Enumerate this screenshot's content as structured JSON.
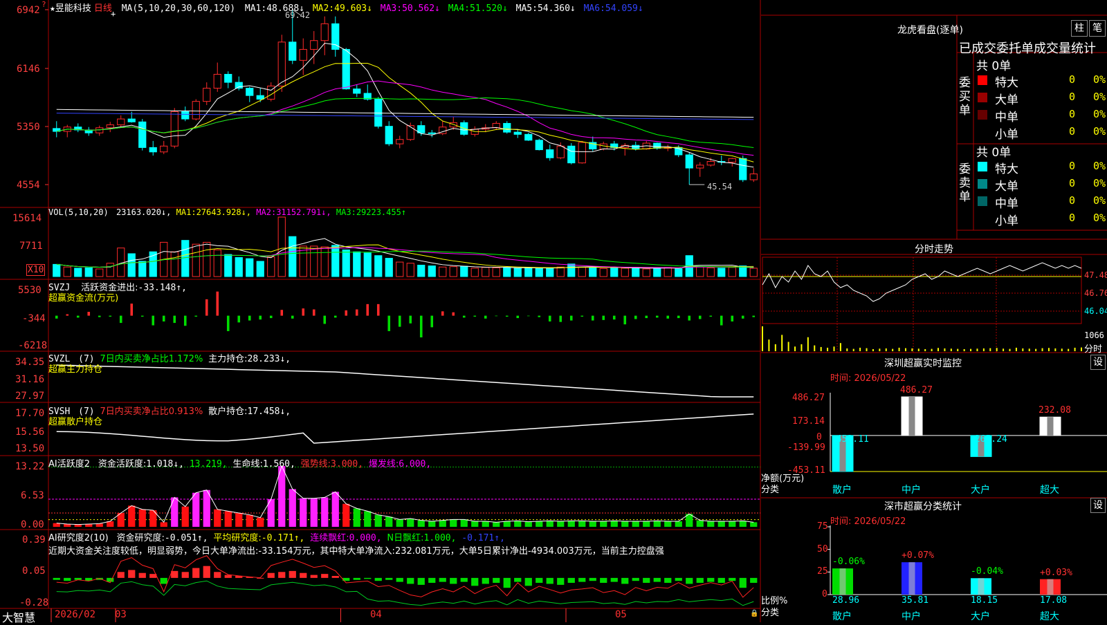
{
  "app": {
    "brand": "大智慧",
    "lock_icon": "lock-icon"
  },
  "colors": {
    "up": "#ff2a2a",
    "down": "#00ffff",
    "green": "#00cc22",
    "ma1": "#ffffff",
    "ma2": "#ffff00",
    "ma3": "#ff00ff",
    "ma4": "#00ff00",
    "ma5": "#ffffff",
    "ma6": "#3344ff",
    "grid": "#aa0000",
    "axis": "#ff3030"
  },
  "kline": {
    "star": "★",
    "stock_name": "昱能科技",
    "period": "日线",
    "ma_params": "MA(5,10,20,30,60,120)",
    "ma_values": [
      {
        "label": "MA1:",
        "value": "48.688↓"
      },
      {
        "label": "MA2:",
        "value": "49.603↓"
      },
      {
        "label": "MA3:",
        "value": "50.562↓"
      },
      {
        "label": "MA4:",
        "value": "51.520↓"
      },
      {
        "label": "MA5:",
        "value": "54.360↓"
      },
      {
        "label": "MA6:",
        "value": "54.059↓"
      }
    ],
    "high_label": "69.42",
    "low_label": "45.54",
    "y_labels": [
      "6942",
      "6146",
      "5350",
      "4554"
    ],
    "ymax": 69.42,
    "ymin": 45.54,
    "candles": [
      [
        53.2,
        54.2,
        52.0,
        52.8
      ],
      [
        52.8,
        53.7,
        52.0,
        53.4
      ],
      [
        53.4,
        53.9,
        52.7,
        53.0
      ],
      [
        53.0,
        53.4,
        52.2,
        52.6
      ],
      [
        52.6,
        53.6,
        52.2,
        53.3
      ],
      [
        53.3,
        54.1,
        52.7,
        53.7
      ],
      [
        53.7,
        55.0,
        53.3,
        54.5
      ],
      [
        54.5,
        55.5,
        54.0,
        54.1
      ],
      [
        54.1,
        54.5,
        50.2,
        50.6
      ],
      [
        50.6,
        51.5,
        49.5,
        50.0
      ],
      [
        50.0,
        51.5,
        49.7,
        50.8
      ],
      [
        50.8,
        56.0,
        50.5,
        55.5
      ],
      [
        55.5,
        56.2,
        54.2,
        54.5
      ],
      [
        54.5,
        57.2,
        54.3,
        56.9
      ],
      [
        56.9,
        59.5,
        56.4,
        58.7
      ],
      [
        58.7,
        62.2,
        58.2,
        60.6
      ],
      [
        60.6,
        61.0,
        58.7,
        59.5
      ],
      [
        59.5,
        60.3,
        58.4,
        58.7
      ],
      [
        58.7,
        58.9,
        56.8,
        57.7
      ],
      [
        57.7,
        58.7,
        56.8,
        57.2
      ],
      [
        57.2,
        59.5,
        56.9,
        59.0
      ],
      [
        59.0,
        66.0,
        58.2,
        65.0
      ],
      [
        65.0,
        69.42,
        62.0,
        62.5
      ],
      [
        62.5,
        65.5,
        60.5,
        64.0
      ],
      [
        64.0,
        66.5,
        62.0,
        65.2
      ],
      [
        65.2,
        68.5,
        63.2,
        67.5
      ],
      [
        67.5,
        68.5,
        63.0,
        64.0
      ],
      [
        64.0,
        64.2,
        58.5,
        58.6
      ],
      [
        58.6,
        59.2,
        57.5,
        58.0
      ],
      [
        58.0,
        59.2,
        57.0,
        57.2
      ],
      [
        57.2,
        57.5,
        53.2,
        53.5
      ],
      [
        53.5,
        54.2,
        50.8,
        51.1
      ],
      [
        51.1,
        52.2,
        50.5,
        51.7
      ],
      [
        51.7,
        54.0,
        51.5,
        53.6
      ],
      [
        53.6,
        54.2,
        52.2,
        52.6
      ],
      [
        52.6,
        53.0,
        52.0,
        52.5
      ],
      [
        52.5,
        54.2,
        52.3,
        53.4
      ],
      [
        53.4,
        54.8,
        53.0,
        54.0
      ],
      [
        54.0,
        54.3,
        52.2,
        52.4
      ],
      [
        52.4,
        53.5,
        52.1,
        53.1
      ],
      [
        53.1,
        53.8,
        52.7,
        53.3
      ],
      [
        53.3,
        54.2,
        53.0,
        53.9
      ],
      [
        53.9,
        54.2,
        52.5,
        52.7
      ],
      [
        52.7,
        53.0,
        51.9,
        52.4
      ],
      [
        52.4,
        52.6,
        51.5,
        51.6
      ],
      [
        51.6,
        51.8,
        50.2,
        50.3
      ],
      [
        50.3,
        51.0,
        48.8,
        49.2
      ],
      [
        49.2,
        51.3,
        49.0,
        50.8
      ],
      [
        50.8,
        51.2,
        48.3,
        48.5
      ],
      [
        48.5,
        51.5,
        48.4,
        51.3
      ],
      [
        51.3,
        52.1,
        50.1,
        50.4
      ],
      [
        50.4,
        51.4,
        50.2,
        51.1
      ],
      [
        51.1,
        51.5,
        50.2,
        50.6
      ],
      [
        50.6,
        51.2,
        49.5,
        50.9
      ],
      [
        50.9,
        51.4,
        50.2,
        50.4
      ],
      [
        50.4,
        51.5,
        50.3,
        51.2
      ],
      [
        51.2,
        51.3,
        50.3,
        50.5
      ],
      [
        50.5,
        51.0,
        50.1,
        50.6
      ],
      [
        50.6,
        50.9,
        49.3,
        49.6
      ],
      [
        49.6,
        49.9,
        45.54,
        47.8
      ],
      [
        47.8,
        48.6,
        46.6,
        48.2
      ],
      [
        48.2,
        49.2,
        48.0,
        48.7
      ],
      [
        48.7,
        49.5,
        48.2,
        48.6
      ],
      [
        48.6,
        49.2,
        48.0,
        49.1
      ],
      [
        49.1,
        49.5,
        45.9,
        46.2
      ],
      [
        46.2,
        47.8,
        45.9,
        47.0
      ]
    ]
  },
  "vol": {
    "params": "VOL(5,10,20)",
    "value": "23163.020↓,",
    "ma": [
      {
        "label": "MA1:",
        "value": "27643.928↓,"
      },
      {
        "label": "MA2:",
        "value": "31152.791↓,"
      },
      {
        "label": "MA3:",
        "value": "29223.455↑"
      }
    ],
    "y_labels": [
      "15614",
      "7711"
    ],
    "unit": "X10",
    "ymax": 15614,
    "values": [
      3200,
      2500,
      2200,
      2300,
      2000,
      3500,
      7500,
      6000,
      4000,
      6500,
      9000,
      6500,
      9500,
      8500,
      9000,
      7000,
      5800,
      5000,
      4700,
      4000,
      5200,
      15614,
      10500,
      8000,
      8000,
      7800,
      8200,
      7000,
      6500,
      6200,
      5500,
      4800,
      3800,
      3500,
      3000,
      2800,
      2500,
      2600,
      2700,
      2200,
      2400,
      2300,
      2400,
      2200,
      2300,
      2100,
      2200,
      2500,
      3300,
      2500,
      2400,
      2100,
      2300,
      2200,
      2400,
      2000,
      2100,
      2400,
      2100,
      5500,
      2600,
      2300,
      2200,
      2400,
      2800,
      2200
    ]
  },
  "svzj": {
    "title": "SVZJ",
    "line1_label": "活跃资金进出:",
    "line1_value": "-33.148↑,",
    "line2": "超赢资金流(万元)",
    "y_labels": [
      "5530",
      "-344",
      "-6218"
    ],
    "ymax": 5530,
    "ymin": -6218,
    "values": [
      -600,
      300,
      -400,
      800,
      -300,
      -200,
      -1500,
      2500,
      -200,
      -2000,
      -1200,
      -1500,
      -2100,
      -200,
      3400,
      5000,
      -3200,
      -1400,
      -1000,
      -800,
      -500,
      1200,
      -600,
      1500,
      1300,
      -1700,
      -400,
      1100,
      1300,
      2400,
      2400,
      -3200,
      -2300,
      -1600,
      -4500,
      -2400,
      900,
      700,
      -400,
      -200,
      -600,
      -100,
      -200,
      -500,
      -100,
      -300,
      -1200,
      -1300,
      -1000,
      -200,
      -1000,
      -900,
      -800,
      -1800,
      -700,
      -500,
      -400,
      -600,
      -500,
      -1000,
      -700,
      -200,
      -2000,
      -1200,
      -600,
      -300
    ]
  },
  "svzl": {
    "title": "SVZL",
    "params": "(7)",
    "ratio_text": "7日内买卖净占比1.172%",
    "holding_label": "主力持仓:",
    "holding_value": "28.233↓,",
    "line2": "超赢主力持仓",
    "y_labels": [
      "34.35",
      "31.16",
      "27.97"
    ],
    "ymax": 34.35,
    "ymin": 27.97
  },
  "svsh": {
    "title": "SVSH",
    "params": "(7)",
    "ratio_text": "7日内买卖净占比0.913%",
    "holding_label": "散户持仓:",
    "holding_value": "17.458↓,",
    "line2": "超赢散户持仓",
    "y_labels": [
      "17.70",
      "15.56",
      "13.50"
    ],
    "ymax": 17.7,
    "ymin": 13.5
  },
  "ai_active": {
    "title": "AI活跃度2",
    "label": "资金活跃度:",
    "value": "1.018↓,",
    "value2": "13.219,",
    "life_label": "生命线:",
    "life_value": "1.560,",
    "strong_label": "强势线:",
    "strong_value": "3.000,",
    "burst_label": "爆发线:",
    "burst_value": "6.000,",
    "y_labels": [
      "13.22",
      "6.53",
      "0.00"
    ],
    "ymax": 13.22,
    "values": [
      0.8,
      0.6,
      0.5,
      0.6,
      0.7,
      1.2,
      3.0,
      4.6,
      3.8,
      3.6,
      1.0,
      6.4,
      4.4,
      7.4,
      8.0,
      3.8,
      3.4,
      3.0,
      2.6,
      2.0,
      6.0,
      13.2,
      8.2,
      6.2,
      6.2,
      6.4,
      7.6,
      5.0,
      4.0,
      3.4,
      2.6,
      2.2,
      1.6,
      1.8,
      1.4,
      1.2,
      1.4,
      1.6,
      1.6,
      1.2,
      1.2,
      1.0,
      1.2,
      1.3,
      1.1,
      1.2,
      1.3,
      1.2,
      1.3,
      1.3,
      1.2,
      1.2,
      1.3,
      1.2,
      1.2,
      1.2,
      1.3,
      1.2,
      1.2,
      2.8,
      1.4,
      1.2,
      1.2,
      1.2,
      1.3,
      1.0
    ]
  },
  "ai_research": {
    "title": "AI研究度2(10)",
    "label": "资金研究度:",
    "value": "-0.051↑,",
    "avg_label": "平均研究度:",
    "avg_value": "-0.171↑,",
    "red_label": "连续飘红:",
    "red_value": "0.000,",
    "nred_label": "N日飘红:",
    "nred_value": "1.000,",
    "last_value": "-0.171↑,",
    "comment": "近期大资金关注度较低，明显弱势，今日大单净流出:-33.154万元，其中特大单净流入:232.081万元，大单5日累计净出-4934.003万元，当前主力控盘强",
    "y_labels": [
      "0.39",
      "0.05",
      "-0.28"
    ],
    "ymax": 0.39,
    "ymin": -0.28,
    "values": [
      -0.02,
      -0.03,
      -0.02,
      -0.03,
      -0.02,
      -0.04,
      0.06,
      0.08,
      0.05,
      0.04,
      -0.06,
      0.07,
      0.06,
      0.1,
      0.12,
      0.06,
      0.03,
      0.02,
      0.01,
      0.0,
      0.05,
      0.06,
      0.07,
      0.05,
      0.03,
      0.04,
      0.02,
      -0.03,
      -0.02,
      -0.01,
      -0.03,
      -0.02,
      -0.04,
      -0.06,
      -0.07,
      -0.05,
      -0.04,
      -0.06,
      -0.04,
      -0.08,
      -0.06,
      -0.05,
      -0.1,
      -0.04,
      -0.08,
      -0.05,
      -0.06,
      -0.07,
      -0.05,
      -0.04,
      -0.03,
      -0.05,
      -0.04,
      -0.06,
      -0.03,
      -0.05,
      -0.04,
      -0.05,
      -0.03,
      -0.06,
      -0.05,
      -0.04,
      -0.05,
      -0.03,
      -0.1,
      -0.05
    ]
  },
  "xaxis": {
    "labels": [
      {
        "text": "2026/02",
        "bar": 0
      },
      {
        "text": "03",
        "bar": 6
      },
      {
        "text": "04",
        "bar": 27
      },
      {
        "text": "05",
        "bar": 48
      }
    ]
  },
  "dragon": {
    "title": "龙虎看盘(逐单)",
    "btn1": "柱",
    "btn2": "笔",
    "subtitle": "已成交委托单成交量统计",
    "buy_vlabel": "委买单",
    "sell_vlabel": "委卖单",
    "buy_total": "共 0单",
    "sell_total": "共 0单",
    "buy_rows": [
      {
        "name": "特大",
        "v": "0",
        "p": "0%",
        "c": "#ff0000"
      },
      {
        "name": "大单",
        "v": "0",
        "p": "0%",
        "c": "#990000"
      },
      {
        "name": "中单",
        "v": "0",
        "p": "0%",
        "c": "#660000"
      },
      {
        "name": "小单",
        "v": "0",
        "p": "0%",
        "c": ""
      }
    ],
    "sell_rows": [
      {
        "name": "特大",
        "v": "0",
        "p": "0%",
        "c": "#00ffff"
      },
      {
        "name": "大单",
        "v": "0",
        "p": "0%",
        "c": "#008888"
      },
      {
        "name": "中单",
        "v": "0",
        "p": "0%",
        "c": "#006666"
      },
      {
        "name": "小单",
        "v": "0",
        "p": "0%",
        "c": ""
      }
    ]
  },
  "minute": {
    "title": "分时走势",
    "y_labels": [
      "47.48",
      "46.76",
      "46.04"
    ],
    "vol_label": "1066",
    "vol_unit": "分时",
    "price_max": 48.2,
    "price_min": 45.8,
    "prices": [
      47.2,
      47.6,
      47.1,
      47.5,
      47.3,
      47.7,
      47.4,
      47.9,
      47.6,
      47.5,
      47.7,
      47.3,
      47.1,
      47.2,
      47.0,
      46.9,
      46.8,
      46.6,
      46.7,
      46.9,
      47.0,
      47.1,
      47.2,
      47.4,
      47.5,
      47.6,
      47.4,
      47.5,
      47.7,
      47.6,
      47.5,
      47.6,
      47.7,
      47.8,
      47.7,
      47.6,
      47.7,
      47.8,
      47.9,
      47.8,
      47.7,
      47.8,
      47.9,
      48.0,
      47.9,
      47.8,
      47.9,
      47.8,
      47.9,
      47.8
    ],
    "avg": [
      47.5,
      47.5,
      47.5,
      47.5,
      47.5,
      47.5,
      47.5,
      47.5,
      47.5,
      47.5,
      47.5,
      47.5,
      47.5,
      47.5,
      47.5,
      47.5,
      47.5,
      47.5,
      47.5,
      47.5,
      47.5,
      47.5,
      47.5,
      47.5,
      47.5,
      47.5,
      47.5,
      47.5,
      47.5,
      47.5,
      47.5,
      47.5,
      47.5,
      47.5,
      47.5,
      47.5,
      47.5,
      47.5,
      47.5,
      47.5,
      47.5,
      47.5,
      47.5,
      47.5,
      47.5,
      47.5,
      47.5,
      47.5,
      47.5,
      47.5
    ],
    "vols": [
      1066,
      500,
      300,
      700,
      400,
      200,
      300,
      600,
      250,
      180,
      150,
      200,
      350,
      120,
      100,
      150,
      130,
      90,
      110,
      120,
      100,
      150,
      130,
      120,
      110,
      90,
      100,
      140,
      120,
      110,
      100,
      90,
      100,
      110,
      120,
      130,
      140,
      110,
      100,
      150,
      120,
      110,
      100,
      130,
      140,
      120,
      110,
      100,
      150,
      160
    ]
  },
  "sz_monitor": {
    "title": "深圳超赢实时监控",
    "btn": "设",
    "time": "时间: 2026/05/22",
    "y_labels": [
      "486.27",
      "173.14",
      "0",
      "-139.99",
      "-453.11"
    ],
    "ymax": 486.27,
    "ymin": -453.11,
    "ylabel1": "净额(万元)",
    "ylabel2": "分类",
    "bars": [
      {
        "cat": "散户",
        "value": -453.11,
        "label": "-453.11",
        "color": "#00ffff"
      },
      {
        "cat": "中户",
        "value": 486.27,
        "label": "486.27",
        "color": "#ffffff"
      },
      {
        "cat": "大户",
        "value": -265.24,
        "label": "-265.24",
        "color": "#00ffff"
      },
      {
        "cat": "超大",
        "value": 232.08,
        "label": "232.08",
        "color": "#ffffff"
      }
    ]
  },
  "sz_class": {
    "title": "深市超赢分类统计",
    "btn": "设",
    "time": "时间: 2026/05/22",
    "y_labels": [
      "75",
      "50",
      "25",
      "0"
    ],
    "ymax": 75,
    "ylabel1": "比例%",
    "ylabel2": "分类",
    "bars": [
      {
        "cat": "散户",
        "value": 28.96,
        "label": "28.96",
        "chg": "-0.06%",
        "color": "#00dd00",
        "chgcolor": "#00ff00"
      },
      {
        "cat": "中户",
        "value": 35.81,
        "label": "35.81",
        "chg": "+0.07%",
        "color": "#2222ff",
        "chgcolor": "#ff3333"
      },
      {
        "cat": "大户",
        "value": 18.15,
        "label": "18.15",
        "chg": "-0.04%",
        "color": "#00ffff",
        "chgcolor": "#00ff00"
      },
      {
        "cat": "超大",
        "value": 17.08,
        "label": "17.08",
        "chg": "+0.03%",
        "color": "#ff2222",
        "chgcolor": "#ff3333"
      }
    ]
  }
}
